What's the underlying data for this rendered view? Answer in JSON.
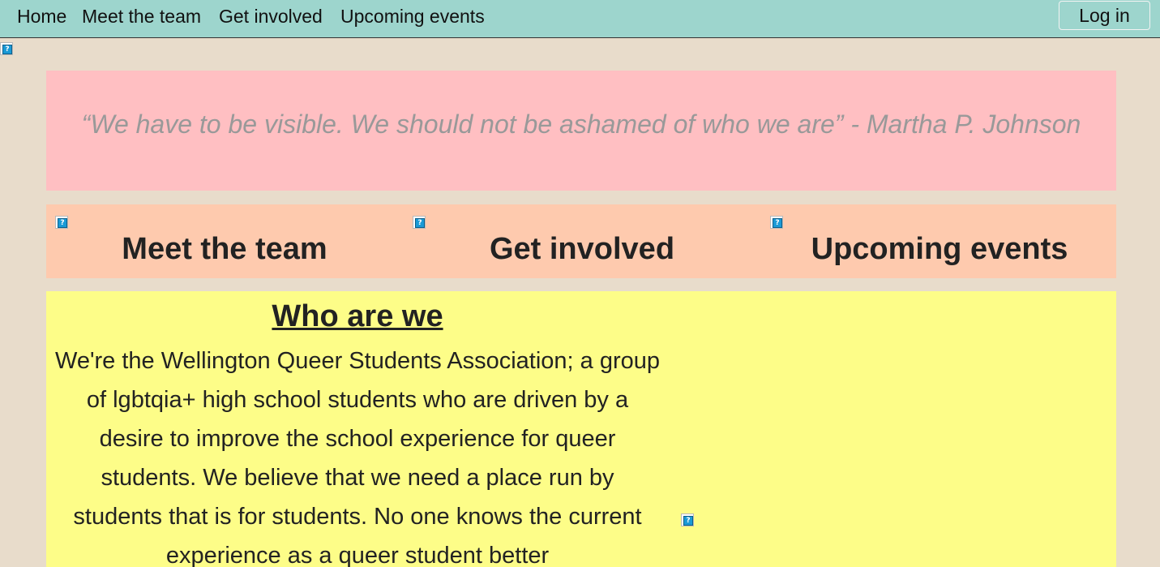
{
  "nav": {
    "links": [
      "Home",
      "Meet the team",
      "Get involved",
      "Upcoming events"
    ],
    "login_label": "Log in"
  },
  "quote": {
    "text": "“We have to be visible. We should not be ashamed of who we are” - Martha P. Johnson"
  },
  "sections": [
    {
      "heading": "Meet the team"
    },
    {
      "heading": "Get involved"
    },
    {
      "heading": "Upcoming events"
    }
  ],
  "about": {
    "title": "Who are we",
    "body": "We're the Wellington Queer Students Association; a group of lgbtqia+ high school students who are driven by a desire to improve the school experience for queer students. We believe that we need a place run by students that is for students. No one knows the current experience as a queer student better"
  },
  "icons": {
    "broken_image": "broken-image-icon"
  },
  "colors": {
    "nav_bg": "#9dd5cd",
    "page_bg": "#e8dccb",
    "quote_bg": "#ffbfc2",
    "links_bg": "#fecaae",
    "about_bg": "#fdfd88",
    "quote_text": "#999999"
  }
}
